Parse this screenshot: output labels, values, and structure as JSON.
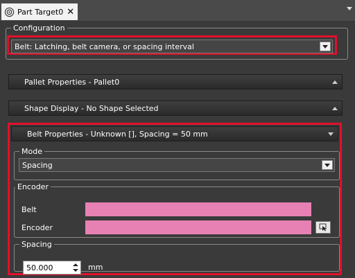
{
  "tab": {
    "title": "Part Target0",
    "close_glyph": "✕",
    "icon": "part-target-icon"
  },
  "configuration": {
    "legend": "Configuration",
    "selected": "Belt: Latching, belt camera, or spacing interval"
  },
  "pallet_properties": {
    "label": "Pallet Properties - Pallet0",
    "state": "collapsed"
  },
  "shape_display": {
    "label": "Shape Display - No Shape Selected",
    "state": "collapsed"
  },
  "belt_properties": {
    "label": "Belt Properties -  Unknown [], Spacing = 50 mm",
    "state": "expanded",
    "mode": {
      "legend": "Mode",
      "selected": "Spacing"
    },
    "encoder": {
      "legend": "Encoder",
      "belt_label": "Belt",
      "encoder_label": "Encoder",
      "field_color": "#e781b3"
    },
    "spacing": {
      "legend": "Spacing",
      "value": "50.000",
      "unit": "mm"
    }
  },
  "colors": {
    "highlight": "#e2102b",
    "background": "#3a3a3a",
    "header": "#2a2a2a"
  }
}
